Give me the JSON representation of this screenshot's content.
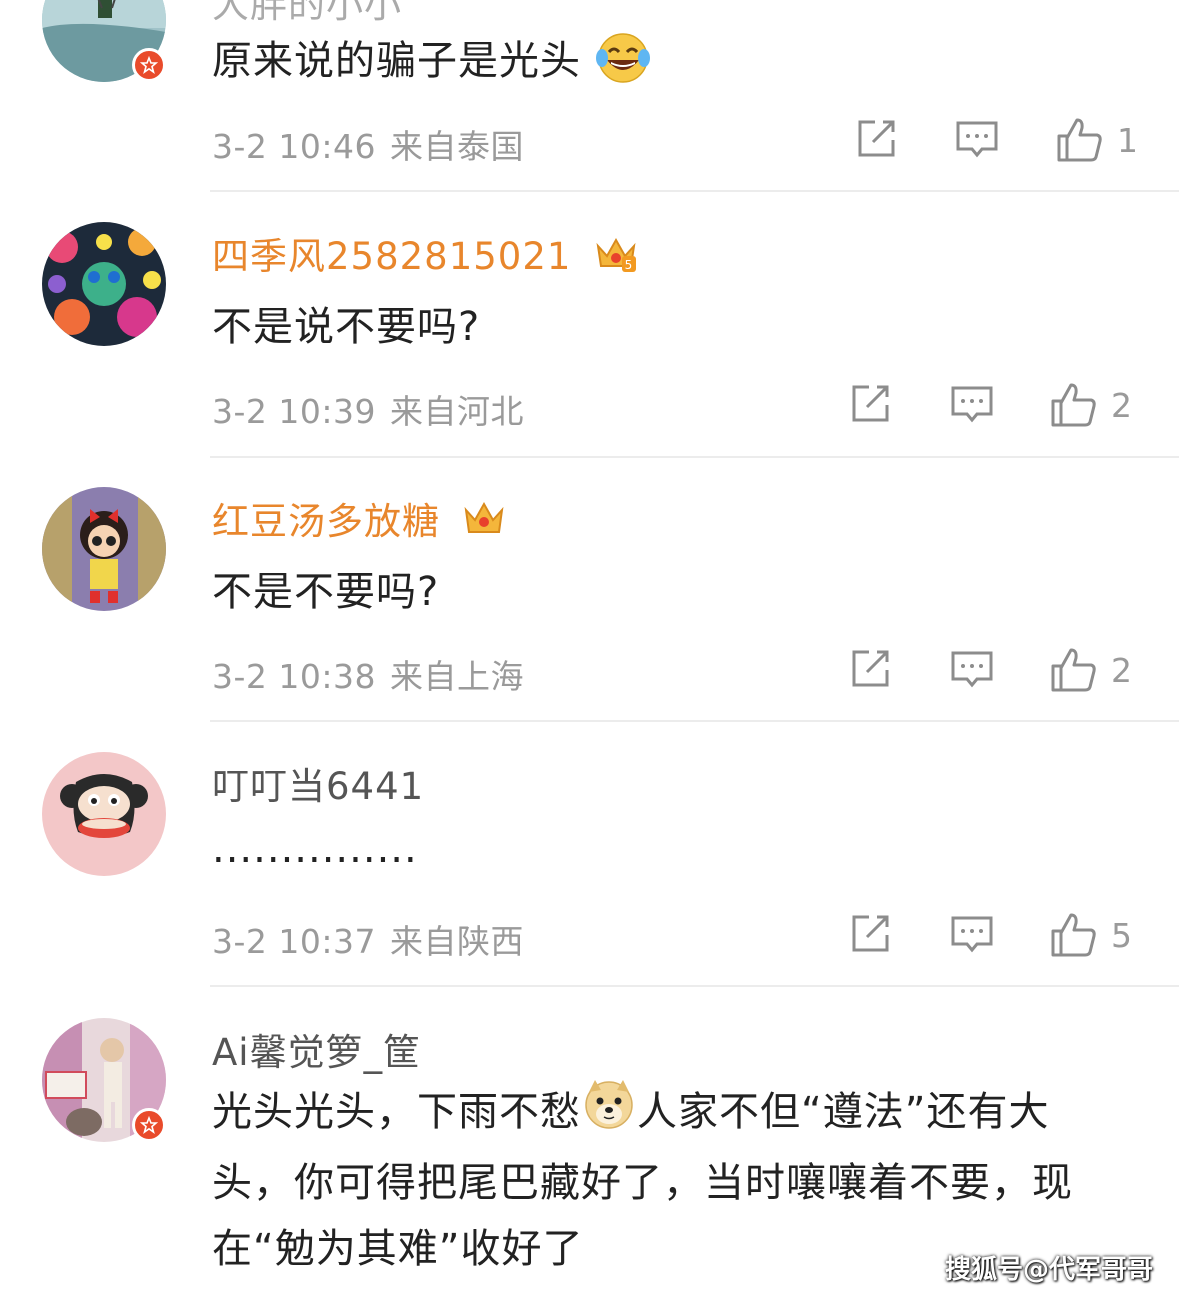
{
  "colors": {
    "vip_name": "#e8862c",
    "normal_name": "#555555",
    "meta": "#9a9a9a",
    "text": "#222222",
    "divider": "#ececec"
  },
  "top_partial_username": "大胖的小小",
  "comments": [
    {
      "username": "",
      "text": "原来说的骗子是光头",
      "emoji": "laughing-tears-emoji",
      "time": "3-2 10:46",
      "location": "来自泰国",
      "likes": "1",
      "verified": true
    },
    {
      "username": "四季风2582815021",
      "text": "不是说不要吗?",
      "badge": "crown-level-5-icon",
      "time": "3-2 10:39",
      "location": "来自河北",
      "likes": "2"
    },
    {
      "username": "红豆汤多放糖",
      "text": "不是不要吗?",
      "badge": "crown-icon",
      "time": "3-2 10:38",
      "location": "来自上海",
      "likes": "2"
    },
    {
      "username": "叮叮当6441",
      "text": "...............",
      "time": "3-2 10:37",
      "location": "来自陕西",
      "likes": "5"
    },
    {
      "username": "Ai馨觉箩_筐",
      "text_part1": "光头光头，下雨不愁",
      "emoji": "doge-emoji",
      "text_part2": "人家不但“遵法”还有大头，你可得把尾巴藏好了，当时嚷嚷着不要，现在“勉为其难”收好了",
      "verified": true
    }
  ],
  "watermark": "搜狐号@代军哥哥"
}
